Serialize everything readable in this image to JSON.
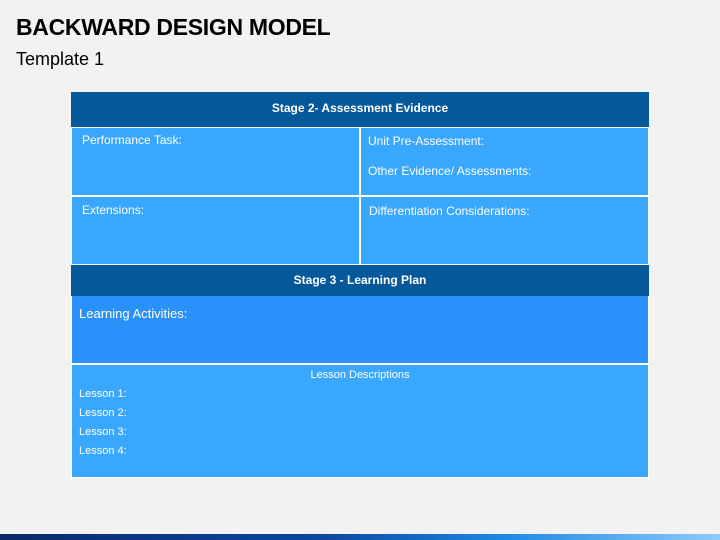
{
  "slide": {
    "title": "BACKWARD DESIGN MODEL",
    "subtitle": "Template 1"
  },
  "stage2": {
    "header": "Stage 2- Assessment Evidence",
    "performance_task": "Performance Task:",
    "unit_pre_assessment": "Unit Pre-Assessment:",
    "other_evidence": "Other Evidence/ Assessments:",
    "extensions": "Extensions:",
    "differentiation": "Differentiation Considerations:"
  },
  "stage3": {
    "header": "Stage 3 - Learning Plan",
    "learning_activities": "Learning Activities:",
    "lesson_descriptions": "Lesson Descriptions",
    "lessons": [
      "Lesson 1:",
      "Lesson 2:",
      "Lesson 3:",
      "Lesson 4:"
    ]
  },
  "colors": {
    "header_bg": "#05589a",
    "cell_bg": "#3aa7ff",
    "learning_bg": "#2a90fa",
    "text": "#ffffff"
  }
}
